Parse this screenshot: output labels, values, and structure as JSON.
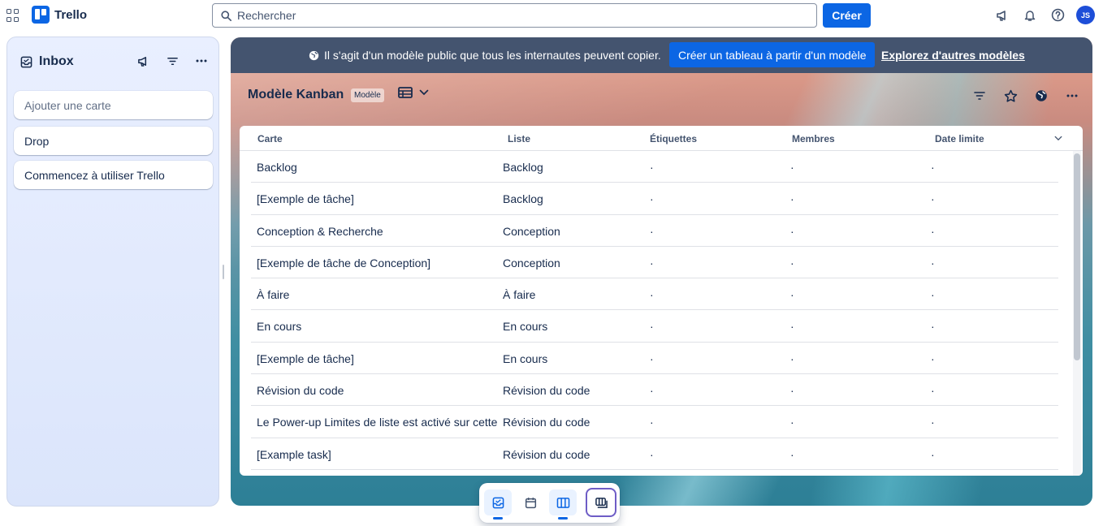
{
  "app": {
    "name": "Trello"
  },
  "search": {
    "placeholder": "Rechercher"
  },
  "topbar": {
    "create_label": "Créer",
    "avatar_initials": "JS"
  },
  "inbox": {
    "title": "Inbox",
    "cards": [
      {
        "label": "Ajouter une carte"
      },
      {
        "label": "Drop"
      },
      {
        "label": "Commencez à utiliser Trello"
      }
    ]
  },
  "banner": {
    "text": "Il s'agit d'un modèle public que tous les internautes peuvent copier.",
    "button_label": "Créer un tableau à partir d'un modèle",
    "link_label": "Explorez d'autres modèles"
  },
  "board": {
    "title": "Modèle Kanban",
    "badge": "Modèle"
  },
  "table": {
    "headers": [
      "Carte",
      "Liste",
      "Étiquettes",
      "Membres",
      "Date limite"
    ],
    "rows": [
      {
        "card": "Backlog",
        "list": "Backlog",
        "labels": "·",
        "members": "·",
        "due": "·"
      },
      {
        "card": "[Exemple de tâche]",
        "list": "Backlog",
        "labels": "·",
        "members": "·",
        "due": "·"
      },
      {
        "card": "Conception & Recherche",
        "list": "Conception",
        "labels": "·",
        "members": "·",
        "due": "·"
      },
      {
        "card": "[Exemple de tâche de Conception]",
        "list": "Conception",
        "labels": "·",
        "members": "·",
        "due": "·"
      },
      {
        "card": "À faire",
        "list": "À faire",
        "labels": "·",
        "members": "·",
        "due": "·"
      },
      {
        "card": "En cours",
        "list": "En cours",
        "labels": "·",
        "members": "·",
        "due": "·"
      },
      {
        "card": "[Exemple de tâche]",
        "list": "En cours",
        "labels": "·",
        "members": "·",
        "due": "·"
      },
      {
        "card": "Révision du code",
        "list": "Révision du code",
        "labels": "·",
        "members": "·",
        "due": "·"
      },
      {
        "card": "Le Power-up Limites de liste est activé sur cette",
        "list": "Révision du code",
        "labels": "·",
        "members": "·",
        "due": "·"
      },
      {
        "card": "[Example task]",
        "list": "Révision du code",
        "labels": "·",
        "members": "·",
        "due": "·"
      }
    ]
  },
  "bottom_bar": {
    "items": [
      "inbox-icon",
      "calendar-icon",
      "board-icon",
      "switch-boards-icon"
    ]
  }
}
